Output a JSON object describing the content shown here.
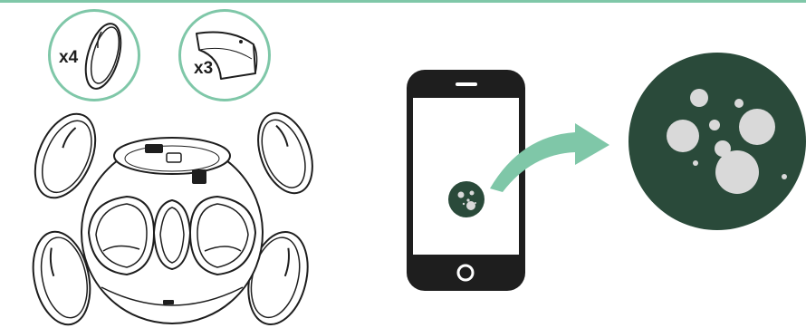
{
  "parts": [
    {
      "id": "lid",
      "count_label": "x4",
      "icon": "lid-part-icon"
    },
    {
      "id": "tray",
      "count_label": "x3",
      "icon": "tray-part-icon"
    }
  ],
  "colors": {
    "accent": "#7fc7a8",
    "dark_green": "#2a4a3a",
    "bubble": "#d9d9d9",
    "line": "#1e1e1e"
  },
  "illustration": {
    "assembly": "spherical-device-exploded-view",
    "phone": "smartphone-with-app-icon",
    "arrow": "curved-arrow",
    "app_logo": "bubbles-app-logo"
  }
}
